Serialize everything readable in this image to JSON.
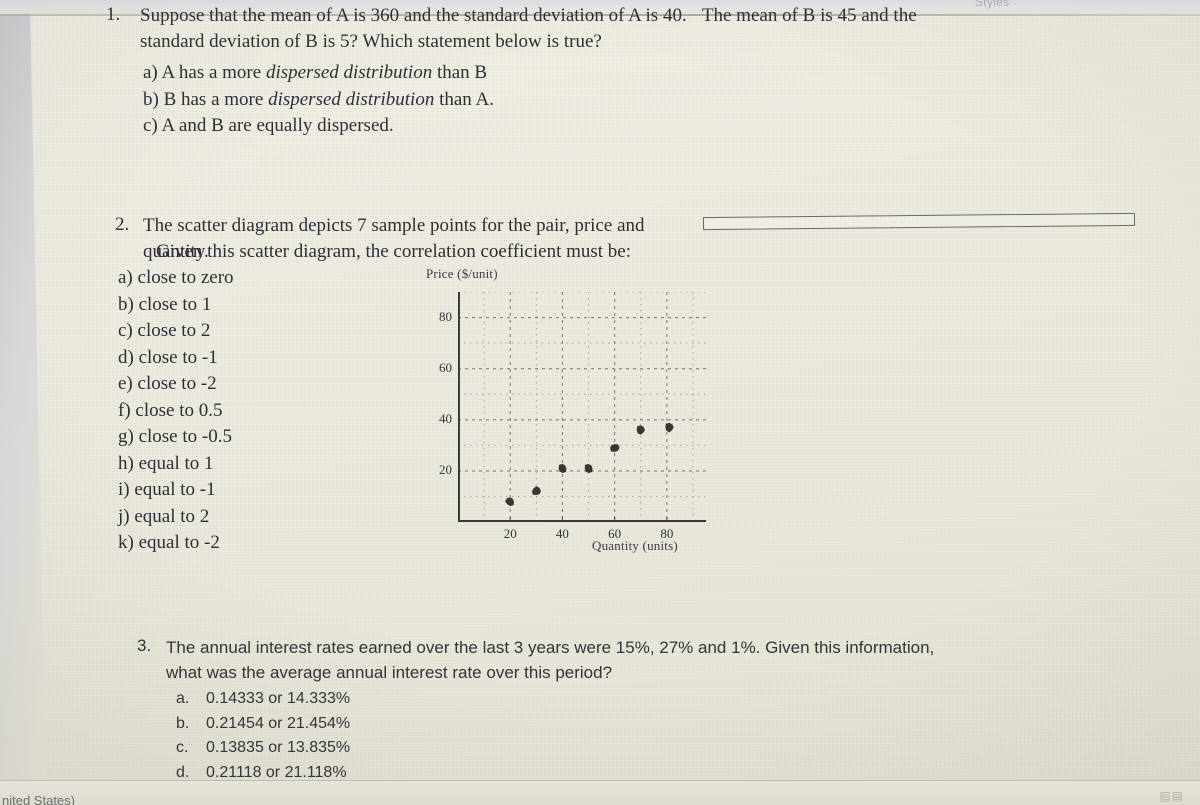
{
  "app": {
    "ribbon_label": "Styles",
    "status_language": "nited States)",
    "status_icon": "page-view-icon"
  },
  "document": {
    "questions": [
      {
        "number": "1.",
        "line1_a": "Suppose that the mean of A is 360 and the standard deviation of A is 40.",
        "line1_b": "The mean of B is 45 and the",
        "line2": "standard deviation of B is 5? Which statement below is true?",
        "options": [
          {
            "label": "a)",
            "pre": "A has a more ",
            "italic": "dispersed distribution",
            "post": " than B"
          },
          {
            "label": "b)",
            "pre": "B has a more ",
            "italic": "dispersed distribution",
            "post": " than A."
          },
          {
            "label": "c)",
            "pre": "A and B are equally dispersed.",
            "italic": "",
            "post": ""
          }
        ]
      },
      {
        "number": "2.",
        "line1": "The scatter diagram depicts 7 sample points for the pair, price and quantity.",
        "line2": "Given this scatter diagram, the correlation coefficient must be:",
        "options": [
          "a) close to zero",
          "b) close to 1",
          "c) close to 2",
          "d) close to -1",
          "e) close to -2",
          "f) close to 0.5",
          "g) close to -0.5",
          "h) equal to 1",
          "i) equal to -1",
          "j) equal to 2",
          "k) equal to -2"
        ]
      },
      {
        "number": "3.",
        "line1": "The annual interest rates earned over the last 3 years were 15%, 27% and 1%.  Given this information,",
        "line2": "what was the average annual interest rate over this period?",
        "options": [
          {
            "label": "a.",
            "text": "0.14333 or 14.333%"
          },
          {
            "label": "b.",
            "text": "0.21454 or 21.454%"
          },
          {
            "label": "c.",
            "text": "0.13835 or 13.835%"
          },
          {
            "label": "d.",
            "text": "0.21118 or 21.118%"
          }
        ]
      }
    ],
    "shapes": [
      {
        "name": "rectangle-shape",
        "kind": "rectangle"
      }
    ]
  },
  "chart_data": {
    "type": "scatter",
    "title": "",
    "ylabel": "Price ($/unit)",
    "xlabel": "Quantity (units)",
    "xlim": [
      0,
      95
    ],
    "ylim": [
      0,
      90
    ],
    "xticks": [
      20,
      40,
      60,
      80
    ],
    "yticks": [
      20,
      40,
      60,
      80
    ],
    "grid": true,
    "grid_style": "dotted",
    "n_points": 7,
    "x": [
      20,
      30,
      40,
      50,
      60,
      70,
      81
    ],
    "y": [
      8,
      12,
      21,
      21,
      29,
      36,
      37
    ],
    "points": [
      {
        "x": 20,
        "y": 8
      },
      {
        "x": 30,
        "y": 12
      },
      {
        "x": 40,
        "y": 21
      },
      {
        "x": 50,
        "y": 21
      },
      {
        "x": 60,
        "y": 29
      },
      {
        "x": 70,
        "y": 36
      },
      {
        "x": 81,
        "y": 37
      }
    ],
    "marker_color": "#2a2a2a",
    "axis_color": "#3a3a3a",
    "relationship": "positive"
  },
  "colors": {
    "paper": "#edebdf",
    "ink": "#2e2e34",
    "shape_outline": "#6b6a62"
  }
}
